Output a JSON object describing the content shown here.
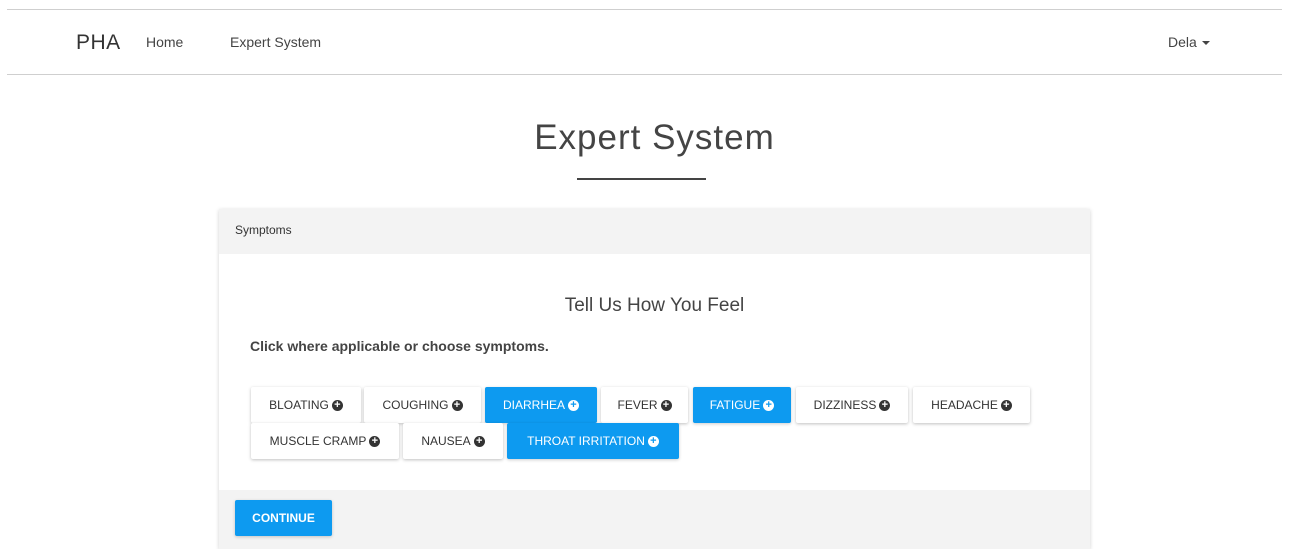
{
  "navbar": {
    "brand": "PHA",
    "links": [
      "Home",
      "Expert System"
    ],
    "user": "Dela"
  },
  "page": {
    "title": "Expert System"
  },
  "panel": {
    "heading": "Symptoms",
    "subtitle": "Tell Us How You Feel",
    "instruction": "Click where applicable or choose symptoms.",
    "symptoms": [
      {
        "label": "BLOATING",
        "selected": false
      },
      {
        "label": "COUGHING",
        "selected": false
      },
      {
        "label": "DIARRHEA",
        "selected": true
      },
      {
        "label": "FEVER",
        "selected": false
      },
      {
        "label": "FATIGUE",
        "selected": true
      },
      {
        "label": "DIZZINESS",
        "selected": false
      },
      {
        "label": "HEADACHE",
        "selected": false
      },
      {
        "label": "MUSCLE CRAMP",
        "selected": false
      },
      {
        "label": "NAUSEA",
        "selected": false
      },
      {
        "label": "THROAT IRRITATION",
        "selected": true
      }
    ],
    "continue_label": "CONTINUE",
    "plus_icon": "plus-circle-icon",
    "accent_color": "#0d9af0"
  }
}
